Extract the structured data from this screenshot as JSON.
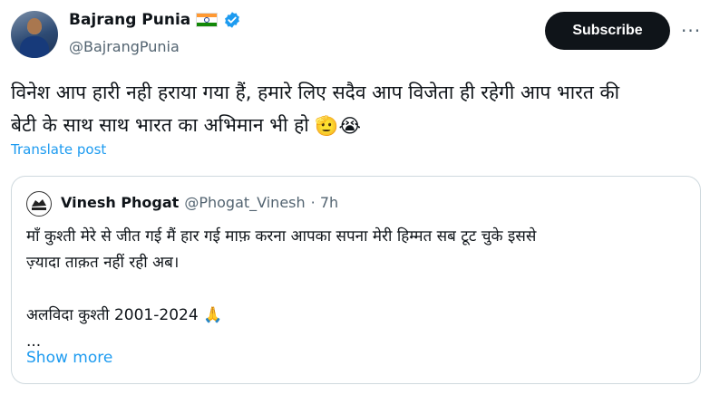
{
  "author": {
    "name": "Bajrang Punia",
    "handle": "@BajrangPunia"
  },
  "actions": {
    "subscribe_label": "Subscribe",
    "more_label": "···"
  },
  "tweet": {
    "text_line1": "विनेश आप हारी नही हराया गया हैं, हमारे लिए सदैव आप विजेता ही रहेगी आप भारत की",
    "text_line2": "बेटी के साथ साथ भारत का अभिमान भी हो",
    "emoji": [
      "🫡",
      "😭"
    ],
    "translate_label": "Translate post"
  },
  "quoted": {
    "name": "Vinesh Phogat",
    "handle": "@Phogat_Vinesh",
    "time": "· 7h",
    "lines": [
      "माँ कुश्ती मेरे से जीत गई मैं हार गई माफ़ करना आपका सपना मेरी हिम्मत सब टूट चुके इससे",
      "ज़्यादा ताक़त नहीं रही अब।",
      "",
      "अलविदा कुश्ती 2001-2024",
      "..."
    ],
    "pray_emoji": "🙏",
    "show_more_label": "Show more"
  },
  "colors": {
    "link": "#1d9bf0",
    "verified": "#1d9bf0",
    "secondary_text": "#536471",
    "button_bg": "#0f1419",
    "border": "#cfd9de"
  },
  "icons": [
    "india-flag-icon",
    "verified-badge-icon",
    "more-options-icon",
    "praying-hands-icon",
    "saluting-face-icon",
    "crying-face-icon"
  ]
}
